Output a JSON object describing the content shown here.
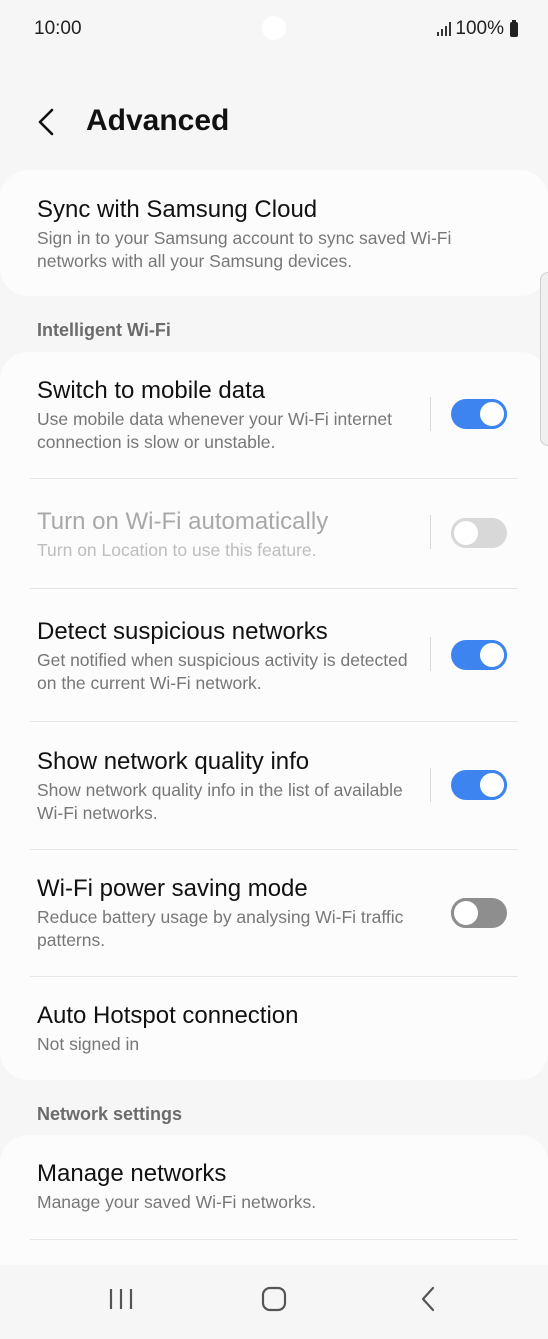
{
  "status_bar": {
    "time": "10:00",
    "battery": "100%"
  },
  "header": {
    "title": "Advanced"
  },
  "sync_card": {
    "title": "Sync with Samsung Cloud",
    "subtitle": "Sign in to your Samsung account to sync saved Wi-Fi networks with all your Samsung devices."
  },
  "intelligent_section": {
    "label": "Intelligent Wi-Fi",
    "items": [
      {
        "title": "Switch to mobile data",
        "subtitle": "Use mobile data whenever your Wi-Fi internet connection is slow or unstable.",
        "toggle": "on"
      },
      {
        "title": "Turn on Wi-Fi automatically",
        "subtitle": "Turn on Location to use this feature.",
        "toggle": "disabled"
      },
      {
        "title": "Detect suspicious networks",
        "subtitle": "Get notified when suspicious activity is detected on the current Wi-Fi network.",
        "toggle": "on"
      },
      {
        "title": "Show network quality info",
        "subtitle": "Show network quality info in the list of available Wi-Fi networks.",
        "toggle": "on"
      },
      {
        "title": "Wi-Fi power saving mode",
        "subtitle": "Reduce battery usage by analysing Wi-Fi traffic patterns.",
        "toggle": "off"
      },
      {
        "title": "Auto Hotspot connection",
        "subtitle": "Not signed in"
      }
    ]
  },
  "network_section": {
    "label": "Network settings",
    "items": [
      {
        "title": "Manage networks",
        "subtitle": "Manage your saved Wi-Fi networks."
      }
    ]
  },
  "icons": {
    "back": "chevron-left-icon",
    "recents": "recents-icon",
    "home": "home-icon",
    "nav_back": "nav-back-icon"
  },
  "colors": {
    "accent": "#3e84f0",
    "background": "#f6f6f6",
    "card": "#fcfcfc"
  }
}
